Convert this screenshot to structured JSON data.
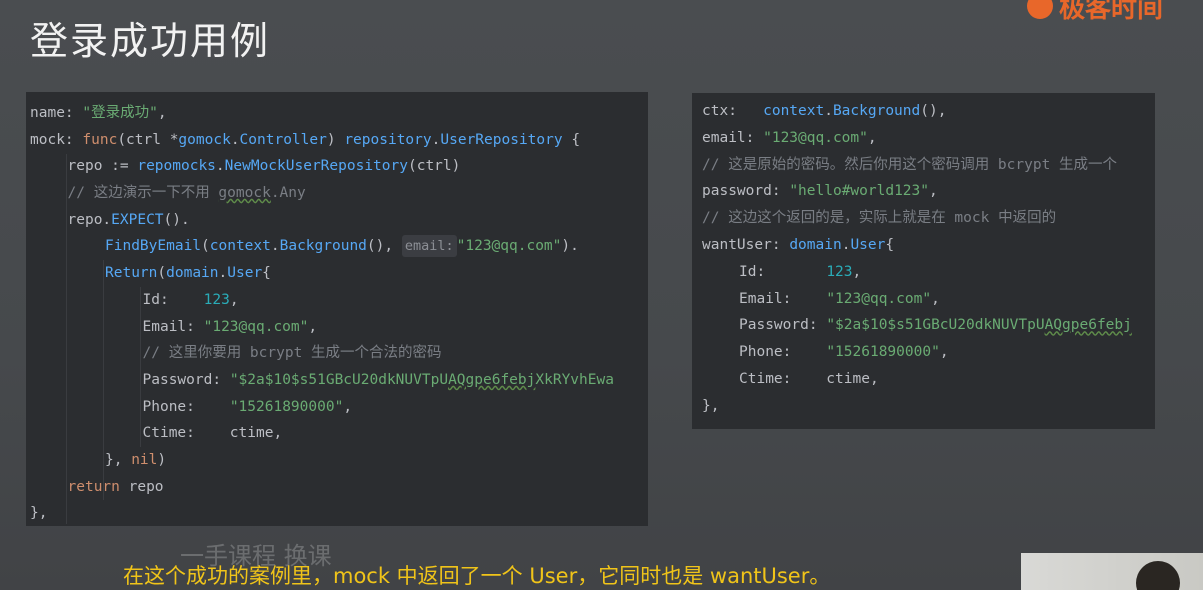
{
  "slide": {
    "title": "登录成功用例",
    "brand": "极客时间"
  },
  "left_code": [
    {
      "i": 0,
      "parts": [
        {
          "c": "p",
          "v": "name: "
        },
        {
          "c": "s",
          "v": "\"登录成功\""
        },
        {
          "c": "p",
          "v": ","
        }
      ]
    },
    {
      "i": 0,
      "parts": [
        {
          "c": "p",
          "v": "mock: "
        },
        {
          "c": "k",
          "v": "func"
        },
        {
          "c": "p",
          "v": "(ctrl *"
        },
        {
          "c": "t",
          "v": "gomock"
        },
        {
          "c": "p",
          "v": "."
        },
        {
          "c": "t",
          "v": "Controller"
        },
        {
          "c": "p",
          "v": ") "
        },
        {
          "c": "t",
          "v": "repository"
        },
        {
          "c": "p",
          "v": "."
        },
        {
          "c": "t",
          "v": "UserRepository"
        },
        {
          "c": "p",
          "v": " {"
        }
      ]
    },
    {
      "i": 1,
      "parts": [
        {
          "c": "p",
          "v": "repo := "
        },
        {
          "c": "t",
          "v": "repomocks"
        },
        {
          "c": "p",
          "v": "."
        },
        {
          "c": "f",
          "v": "NewMockUserRepository"
        },
        {
          "c": "p",
          "v": "(ctrl)"
        }
      ]
    },
    {
      "i": 1,
      "parts": [
        {
          "c": "c",
          "v": "// 这边演示一下不用 "
        },
        {
          "c": "cu",
          "v": "gomock"
        },
        {
          "c": "c",
          "v": ".Any"
        }
      ]
    },
    {
      "i": 1,
      "parts": [
        {
          "c": "p",
          "v": "repo."
        },
        {
          "c": "f",
          "v": "EXPECT"
        },
        {
          "c": "p",
          "v": "()."
        }
      ]
    },
    {
      "i": 2,
      "parts": [
        {
          "c": "f",
          "v": "FindByEmail"
        },
        {
          "c": "p",
          "v": "("
        },
        {
          "c": "t",
          "v": "context"
        },
        {
          "c": "p",
          "v": "."
        },
        {
          "c": "f",
          "v": "Background"
        },
        {
          "c": "p",
          "v": "(), "
        },
        {
          "c": "h",
          "v": "email:"
        },
        {
          "c": "s",
          "v": "\"123@qq.com\""
        },
        {
          "c": "p",
          "v": ")."
        }
      ]
    },
    {
      "i": 2,
      "parts": [
        {
          "c": "f",
          "v": "Return"
        },
        {
          "c": "p",
          "v": "("
        },
        {
          "c": "t",
          "v": "domain"
        },
        {
          "c": "p",
          "v": "."
        },
        {
          "c": "t",
          "v": "User"
        },
        {
          "c": "p",
          "v": "{"
        }
      ]
    },
    {
      "i": 3,
      "parts": [
        {
          "c": "p",
          "v": "Id:    "
        },
        {
          "c": "n",
          "v": "123"
        },
        {
          "c": "p",
          "v": ","
        }
      ]
    },
    {
      "i": 3,
      "parts": [
        {
          "c": "p",
          "v": "Email: "
        },
        {
          "c": "s",
          "v": "\"123@qq.com\""
        },
        {
          "c": "p",
          "v": ","
        }
      ]
    },
    {
      "i": 3,
      "parts": [
        {
          "c": "c",
          "v": "// 这里你要用 bcrypt 生成一个合法的密码"
        }
      ]
    },
    {
      "i": 3,
      "parts": [
        {
          "c": "p",
          "v": "Password: "
        },
        {
          "c": "s",
          "v": "\"$2a$10$s51GBcU20dkNUVTpU"
        },
        {
          "c": "su",
          "v": "AQgpe6febj"
        },
        {
          "c": "s",
          "v": "XkRYvhEwa"
        }
      ]
    },
    {
      "i": 3,
      "parts": [
        {
          "c": "p",
          "v": "Phone:    "
        },
        {
          "c": "s",
          "v": "\"15261890000\""
        },
        {
          "c": "p",
          "v": ","
        }
      ]
    },
    {
      "i": 3,
      "parts": [
        {
          "c": "p",
          "v": "Ctime:    ctime,"
        }
      ]
    },
    {
      "i": 2,
      "parts": [
        {
          "c": "p",
          "v": "}, "
        },
        {
          "c": "k",
          "v": "nil"
        },
        {
          "c": "p",
          "v": ")"
        }
      ]
    },
    {
      "i": 1,
      "parts": [
        {
          "c": "k",
          "v": "return"
        },
        {
          "c": "p",
          "v": " repo"
        }
      ]
    },
    {
      "i": 0,
      "parts": [
        {
          "c": "p",
          "v": "},"
        }
      ]
    }
  ],
  "right_code": [
    {
      "i": 0,
      "parts": [
        {
          "c": "p",
          "v": "ctx:   "
        },
        {
          "c": "t",
          "v": "context"
        },
        {
          "c": "p",
          "v": "."
        },
        {
          "c": "f",
          "v": "Background"
        },
        {
          "c": "p",
          "v": "(),"
        }
      ]
    },
    {
      "i": 0,
      "parts": [
        {
          "c": "p",
          "v": "email: "
        },
        {
          "c": "s",
          "v": "\"123@qq.com\""
        },
        {
          "c": "p",
          "v": ","
        }
      ]
    },
    {
      "i": 0,
      "parts": [
        {
          "c": "c",
          "v": "// 这是原始的密码。然后你用这个密码调用 bcrypt 生成一个"
        }
      ]
    },
    {
      "i": 0,
      "parts": [
        {
          "c": "p",
          "v": "password: "
        },
        {
          "c": "s",
          "v": "\"hello#world123\""
        },
        {
          "c": "p",
          "v": ","
        }
      ]
    },
    {
      "i": 0,
      "parts": [
        {
          "c": "c",
          "v": "// 这边这个返回的是，实际上就是在 mock 中返回的"
        }
      ]
    },
    {
      "i": 0,
      "parts": [
        {
          "c": "p",
          "v": "wantUser: "
        },
        {
          "c": "t",
          "v": "domain"
        },
        {
          "c": "p",
          "v": "."
        },
        {
          "c": "t",
          "v": "User"
        },
        {
          "c": "p",
          "v": "{"
        }
      ]
    },
    {
      "i": 1,
      "parts": [
        {
          "c": "p",
          "v": "Id:       "
        },
        {
          "c": "n",
          "v": "123"
        },
        {
          "c": "p",
          "v": ","
        }
      ]
    },
    {
      "i": 1,
      "parts": [
        {
          "c": "p",
          "v": "Email:    "
        },
        {
          "c": "s",
          "v": "\"123@qq.com\""
        },
        {
          "c": "p",
          "v": ","
        }
      ]
    },
    {
      "i": 1,
      "parts": [
        {
          "c": "p",
          "v": "Password: "
        },
        {
          "c": "s",
          "v": "\"$2a$10$s51GBcU20dkNUVTpU"
        },
        {
          "c": "su",
          "v": "AQgpe6febj"
        }
      ]
    },
    {
      "i": 1,
      "parts": [
        {
          "c": "p",
          "v": "Phone:    "
        },
        {
          "c": "s",
          "v": "\"15261890000\""
        },
        {
          "c": "p",
          "v": ","
        }
      ]
    },
    {
      "i": 1,
      "parts": [
        {
          "c": "p",
          "v": "Ctime:    ctime,"
        }
      ]
    },
    {
      "i": 0,
      "parts": [
        {
          "c": "p",
          "v": "},"
        }
      ]
    }
  ],
  "subtitle": "在这个成功的案例里，mock 中返回了一个 User，它同时也是 wantUser。",
  "watermark": "一手课程 换课",
  "colors": {
    "background": "#46494c",
    "code_bg": "#2b2d30",
    "keyword": "#cf8e6d",
    "string": "#6aab73",
    "number": "#2aacb8",
    "comment": "#7a7e85",
    "type": "#56a8f5",
    "subtitle": "#f0c419",
    "brand": "#e8672a"
  }
}
